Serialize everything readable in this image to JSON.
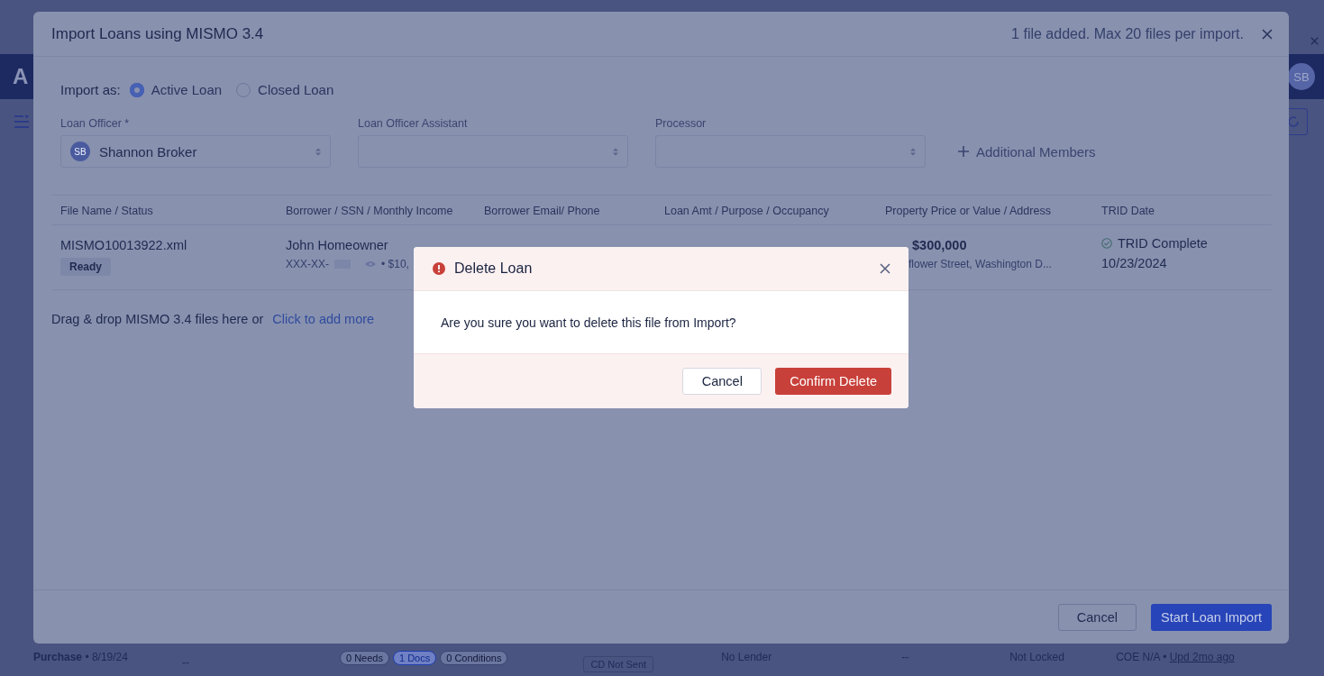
{
  "background": {
    "logo": "A",
    "avatar": "SB",
    "row": {
      "purpose": "Purchase",
      "date": "• 8/19/24",
      "dash_1": "--",
      "badges": [
        {
          "label": "0 Needs",
          "highlighted": false
        },
        {
          "label": "1 Docs",
          "highlighted": true
        },
        {
          "label": "0 Conditions",
          "highlighted": false
        }
      ],
      "cd_status": "CD Not Sent",
      "lender": "No Lender",
      "dash_2": "--",
      "lock": "Not Locked",
      "coe": "COE N/A •",
      "updated": "Upd 2mo ago"
    }
  },
  "import_modal": {
    "title": "Import Loans using MISMO 3.4",
    "file_count": "1 file added. Max 20 files per import.",
    "import_as": {
      "label": "Import as:",
      "options": [
        {
          "label": "Active Loan",
          "selected": true
        },
        {
          "label": "Closed Loan",
          "selected": false
        }
      ]
    },
    "fields": [
      {
        "label": "Loan Officer *",
        "value": "Shannon Broker",
        "avatar": "SB"
      },
      {
        "label": "Loan Officer Assistant"
      },
      {
        "label": "Processor"
      }
    ],
    "add_members": "Additional Members",
    "table": {
      "columns": [
        "File Name / Status",
        "Borrower / SSN / Monthly Income",
        "Borrower Email/ Phone",
        "Loan Amt / Purpose / Occupancy",
        "Property Price or Value / Address",
        "TRID Date"
      ],
      "rows": [
        {
          "file_name": "MISMO10013922.xml",
          "status": "Ready",
          "borrower": "John Homeowner",
          "ssn": "XXX-XX-",
          "income": "• $10,",
          "price": "$300,000",
          "address": "flower Street, Washington D...",
          "trid_status": "TRID Complete",
          "trid_date": "10/23/2024"
        }
      ]
    },
    "drop_text": "Drag & drop MISMO 3.4 files here or",
    "drop_link": "Click to add more",
    "buttons": {
      "cancel": "Cancel",
      "start": "Start Loan Import"
    }
  },
  "delete_dialog": {
    "title": "Delete Loan",
    "message": "Are you sure you want to delete this file from Import?",
    "cancel": "Cancel",
    "confirm": "Confirm Delete"
  }
}
